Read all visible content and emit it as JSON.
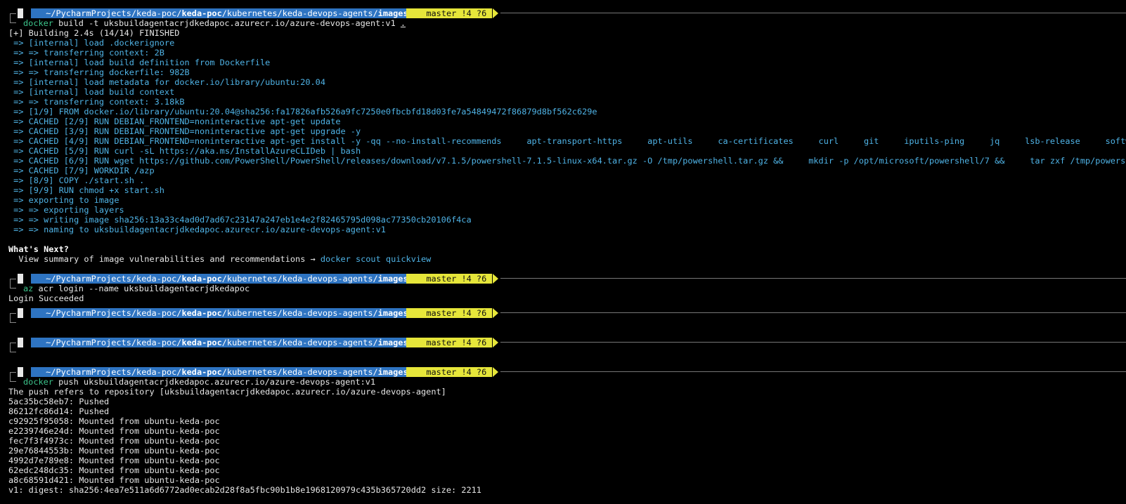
{
  "prompt": {
    "os_icon": "",
    "folder_icon": "",
    "path_prefix": "~/PycharmProjects/keda-poc/",
    "path_bold1": "keda-poc",
    "path_mid": "/kubernetes/keda-devops-agents/",
    "path_bold2": "images",
    "git_icons": " ",
    "git_branch": "master !4 ?6"
  },
  "block1": {
    "cmd_name": "docker",
    "cmd_args": " build -t uksbuildagentacrjdkedapoc.azurecr.io/azure-devops-agent:v1 ",
    "cmd_dot": ".",
    "header": "[+] Building 2.4s (14/14) FINISHED",
    "lines": [
      " => [internal] load .dockerignore",
      " => => transferring context: 2B",
      " => [internal] load build definition from Dockerfile",
      " => => transferring dockerfile: 982B",
      " => [internal] load metadata for docker.io/library/ubuntu:20.04",
      " => [internal] load build context",
      " => => transferring context: 3.18kB",
      " => [1/9] FROM docker.io/library/ubuntu:20.04@sha256:fa17826afb526a9fc7250e0fbcbfd18d03fe7a54849472f86879d8bf562c629e",
      " => CACHED [2/9] RUN DEBIAN_FRONTEND=noninteractive apt-get update",
      " => CACHED [3/9] RUN DEBIAN_FRONTEND=noninteractive apt-get upgrade -y",
      " => CACHED [4/9] RUN DEBIAN_FRONTEND=noninteractive apt-get install -y -qq --no-install-recommends     apt-transport-https     apt-utils     ca-certificates     curl     git     iputils-ping     jq     lsb-release     software-",
      " => CACHED [5/9] RUN curl -sL https://aka.ms/InstallAzureCLIDeb | bash",
      " => CACHED [6/9] RUN wget https://github.com/PowerShell/PowerShell/releases/download/v7.1.5/powershell-7.1.5-linux-x64.tar.gz -O /tmp/powershell.tar.gz &&     mkdir -p /opt/microsoft/powershell/7 &&     tar zxf /tmp/powershell.",
      " => CACHED [7/9] WORKDIR /azp",
      " => [8/9] COPY ./start.sh .",
      " => [9/9] RUN chmod +x start.sh",
      " => exporting to image",
      " => => exporting layers",
      " => => writing image sha256:13a33c4ad0d7ad67c23147a247eb1e4e2f82465795d098ac77350cb20106f4ca",
      " => => naming to uksbuildagentacrjdkedapoc.azurecr.io/azure-devops-agent:v1"
    ],
    "whats_next": "What's Next?",
    "summary_text": "  View summary of image vulnerabilities and recommendations → ",
    "summary_cmd": "docker scout quickview"
  },
  "block2": {
    "cmd_name": "az",
    "cmd_args": " acr login --name uksbuildagentacrjdkedapoc",
    "output": "Login Succeeded"
  },
  "block5": {
    "cmd_name": "docker",
    "cmd_args": " push uksbuildagentacrjdkedapoc.azurecr.io/azure-devops-agent:v1",
    "lines": [
      "The push refers to repository [uksbuildagentacrjdkedapoc.azurecr.io/azure-devops-agent]",
      "5ac35bc58eb7: Pushed",
      "86212fc86d14: Pushed",
      "c92925f95058: Mounted from ubuntu-keda-poc",
      "e2239746e24d: Mounted from ubuntu-keda-poc",
      "fec7f3f4973c: Mounted from ubuntu-keda-poc",
      "29e76844553b: Mounted from ubuntu-keda-poc",
      "4992d7e789e8: Mounted from ubuntu-keda-poc",
      "62edc248dc35: Mounted from ubuntu-keda-poc",
      "a8c68591d421: Mounted from ubuntu-keda-poc",
      "v1: digest: sha256:4ea7e511a6d6772ad0ecab2d28f8a5fbc90b1b8e1968120979c435b365720dd2 size: 2211"
    ]
  }
}
